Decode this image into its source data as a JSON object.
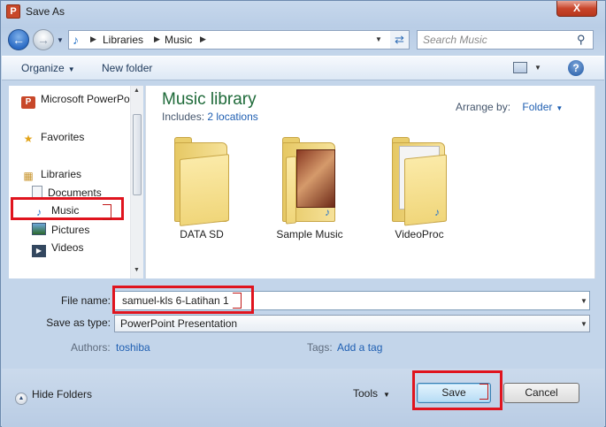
{
  "window": {
    "title": "Save As",
    "close_glyph": "X"
  },
  "address": {
    "crumbs": [
      "Libraries",
      "Music"
    ]
  },
  "search": {
    "placeholder": "Search Music"
  },
  "toolbar": {
    "organize": "Organize",
    "new_folder": "New folder",
    "help": "?"
  },
  "nav": {
    "items": [
      {
        "label": "Microsoft PowerPo",
        "icon": "powerpoint-icon"
      },
      {
        "label": "Favorites",
        "icon": "star-icon"
      },
      {
        "label": "Libraries",
        "icon": "libraries-icon"
      },
      {
        "label": "Documents",
        "icon": "documents-icon"
      },
      {
        "label": "Music",
        "icon": "music-icon"
      },
      {
        "label": "Pictures",
        "icon": "pictures-icon"
      },
      {
        "label": "Videos",
        "icon": "videos-icon"
      }
    ]
  },
  "content": {
    "title": "Music library",
    "includes_label": "Includes:",
    "includes_link": "2 locations",
    "arrange_label": "Arrange by:",
    "arrange_value": "Folder",
    "folders": [
      {
        "name": "DATA SD",
        "icon": "folder-icon"
      },
      {
        "name": "Sample Music",
        "icon": "album-folder-icon"
      },
      {
        "name": "VideoProc",
        "icon": "folder-icon"
      }
    ]
  },
  "form": {
    "file_name_label": "File name:",
    "file_name_value": "samuel-kls 6-Latihan 1",
    "save_type_label": "Save as type:",
    "save_type_value": "PowerPoint Presentation",
    "authors_label": "Authors:",
    "authors_value": "toshiba",
    "tags_label": "Tags:",
    "tags_value": "Add a tag"
  },
  "footer": {
    "hide_folders": "Hide Folders",
    "tools": "Tools",
    "save": "Save",
    "cancel": "Cancel"
  },
  "colors": {
    "annotation_red": "#e0141e",
    "library_title": "#1e6a39",
    "link_blue": "#1f5fb2"
  }
}
